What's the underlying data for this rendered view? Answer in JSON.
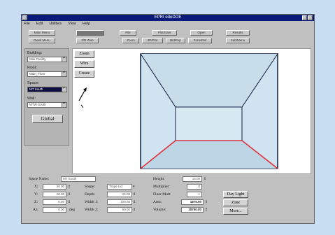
{
  "window": {
    "title": "EPRI edeDOE"
  },
  "menu": [
    "File",
    "Edit",
    "Utilities",
    "View",
    "Help"
  ],
  "toolbar": {
    "row1": [
      "Main Menu",
      "",
      "File",
      "Plot/Gain",
      "Open",
      "Results"
    ],
    "row2": [
      "Dwell Menu",
      "3/D Wire",
      "Zoom",
      "3D/Plot",
      "Bld/Exp",
      "Zone/Ref",
      "Sub/Menu"
    ]
  },
  "left_panel": {
    "building_label": "Building:",
    "building_value": "Mini Facility",
    "floor_label": "Floor:",
    "floor_value": "Main_Floor",
    "space_label": "Space:",
    "space_value": "MT South",
    "wall_label": "Wall:",
    "wall_value": "MTW South",
    "global_button": "Global"
  },
  "tools": {
    "zoom": "Zoom",
    "wire": "Wire",
    "create": "Create"
  },
  "form": {
    "space_name_label": "Space Name:",
    "space_name_value": "MT South",
    "x_label": "X:",
    "x_value": "20.00",
    "y_label": "Y:",
    "y_value": "20.00",
    "z_label": "Z:",
    "z_value": "0.00",
    "az_label": "Az:",
    "az_value": "0.00",
    "az_unit": "deg",
    "shape_label": "Shape:",
    "shape_value": "Trape Lid",
    "depth_label": "Depth:",
    "depth_value": "25.00",
    "width1_label": "Width 1:",
    "width1_value": "100.00",
    "width2_label": "Width 2:",
    "width2_value": "50.00",
    "height_label": "Height:",
    "height_value": "15.00",
    "multiplier_label": "Multiplier:",
    "multiplier_value": "0",
    "floor_mult_label": "Floor Mult:",
    "floor_mult_value": "1",
    "area_label": "Area:",
    "area_value": "1875.00",
    "volume_label": "Volume:",
    "volume_value": "18750.00",
    "daylight_button": "Day Light",
    "zone_button": "Zone",
    "more_button": "More..."
  }
}
